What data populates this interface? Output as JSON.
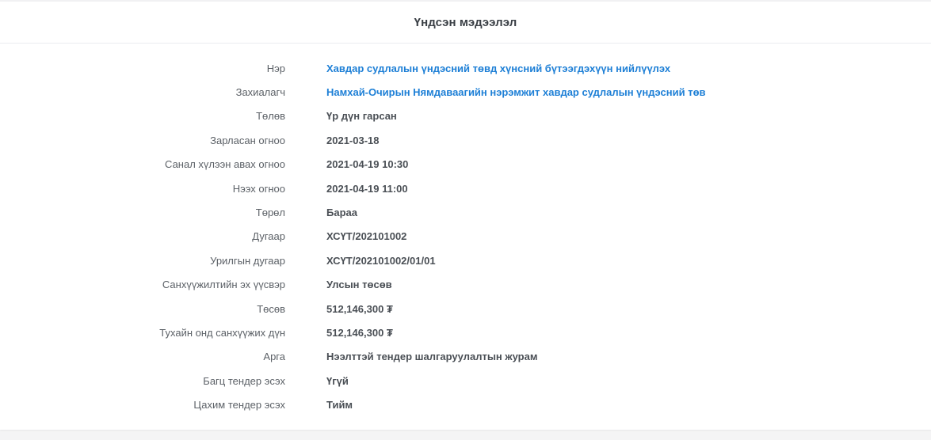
{
  "panel": {
    "title": "Үндсэн мэдээлэл"
  },
  "details": [
    {
      "label": "Нэр",
      "value": "Хавдар судлалын үндэсний төвд хүнсний бүтээгдэхүүн нийлүүлэх",
      "link": true
    },
    {
      "label": "Захиалагч",
      "value": "Намхай-Очирын Нямдаваагийн нэрэмжит хавдар судлалын үндэсний төв",
      "link": true
    },
    {
      "label": "Төлөв",
      "value": "Үр дүн гарсан",
      "link": false
    },
    {
      "label": "Зарласан огноо",
      "value": "2021-03-18",
      "link": false
    },
    {
      "label": "Санал хүлээн авах огноо",
      "value": "2021-04-19 10:30",
      "link": false
    },
    {
      "label": "Нээх огноо",
      "value": "2021-04-19 11:00",
      "link": false
    },
    {
      "label": "Төрөл",
      "value": "Бараа",
      "link": false
    },
    {
      "label": "Дугаар",
      "value": "ХСҮТ/202101002",
      "link": false
    },
    {
      "label": "Урилгын дугаар",
      "value": "ХСҮТ/202101002/01/01",
      "link": false
    },
    {
      "label": "Санхүүжилтийн эх үүсвэр",
      "value": "Улсын төсөв",
      "link": false
    },
    {
      "label": "Төсөв",
      "value": "512,146,300 ₮",
      "link": false
    },
    {
      "label": "Тухайн онд санхүүжих дүн",
      "value": "512,146,300 ₮",
      "link": false
    },
    {
      "label": "Арга",
      "value": "Нээлттэй тендер шалгаруулалтын журам",
      "link": false
    },
    {
      "label": "Багц тендер эсэх",
      "value": "Үгүй",
      "link": false
    },
    {
      "label": "Цахим тендер эсэх",
      "value": "Тийм",
      "link": false
    }
  ],
  "colors": {
    "link": "#1d7fd6",
    "label": "#5c6167",
    "value": "#4a4f55"
  }
}
